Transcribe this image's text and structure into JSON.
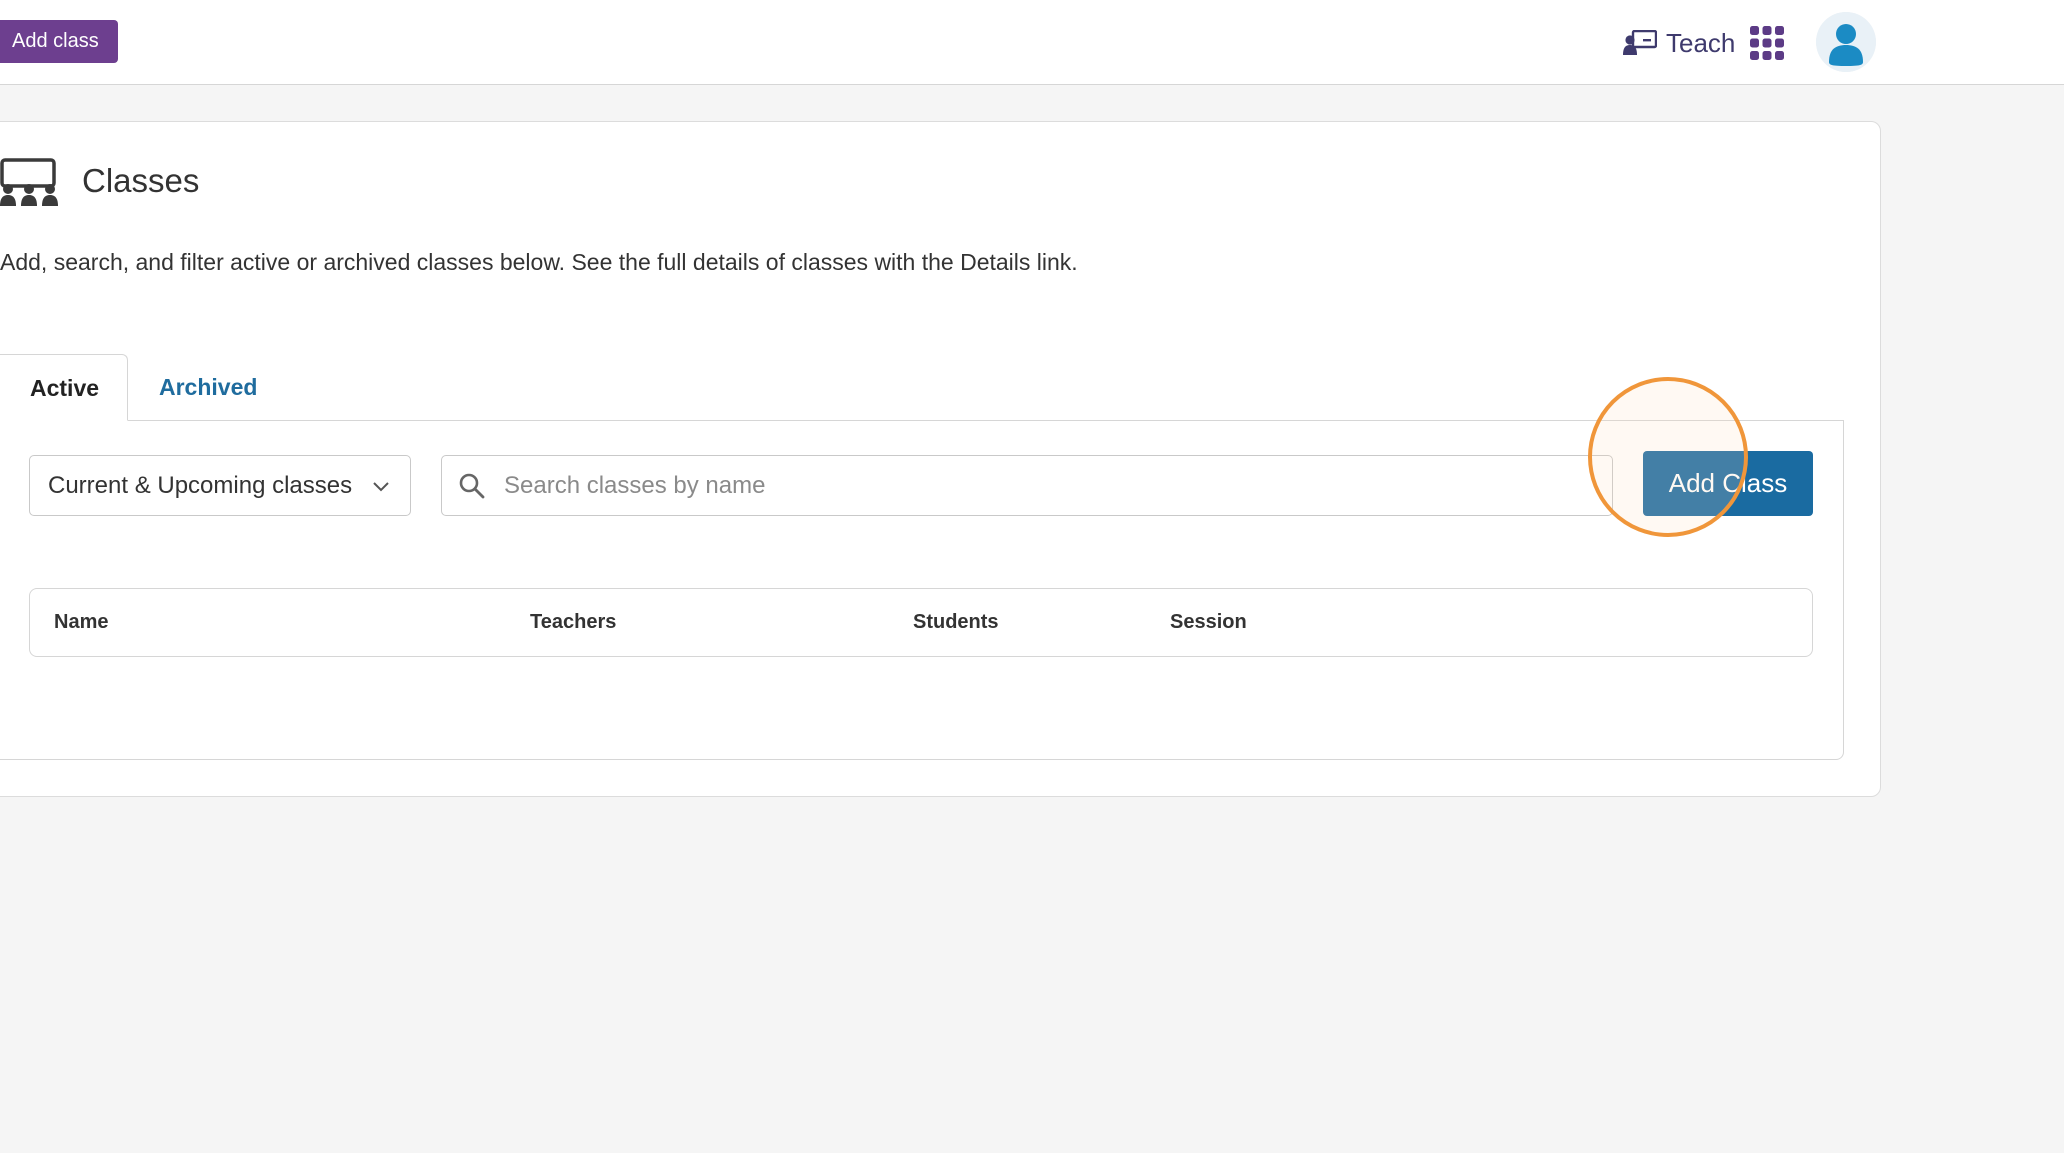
{
  "colors": {
    "brand_purple": "#6d3f8f",
    "primary_blue": "#1a6ba1",
    "link_blue": "#1f6c9e",
    "highlight_orange": "#f0963a"
  },
  "topbar": {
    "add_class_label": "Add class",
    "teach_label": "Teach",
    "teach_icon": "teacher-board-icon",
    "apps_icon": "apps-grid-icon",
    "avatar_icon": "user-avatar-icon"
  },
  "page": {
    "icon": "classroom-icon",
    "title": "Classes",
    "description": "Add, search, and filter active or archived classes below. See the full details of classes with the Details link."
  },
  "tabs": [
    {
      "label": "Active",
      "selected": true
    },
    {
      "label": "Archived",
      "selected": false
    }
  ],
  "filters": {
    "session_filter_value": "Current & Upcoming classes",
    "search_placeholder": "Search classes by name",
    "search_value": ""
  },
  "actions": {
    "add_class_label": "Add Class"
  },
  "table": {
    "columns": [
      "Name",
      "Teachers",
      "Students",
      "Session"
    ],
    "rows": []
  }
}
